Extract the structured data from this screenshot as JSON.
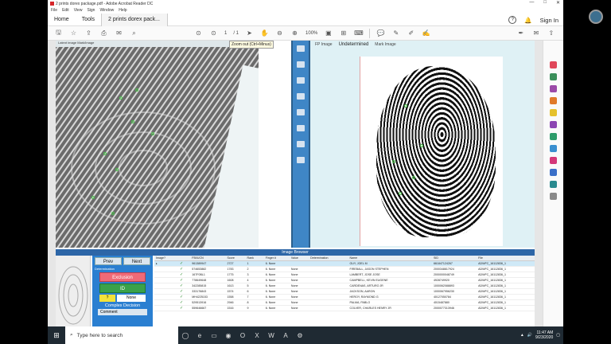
{
  "window": {
    "title": "2 prints dorex package.pdf - Adobe Acrobat Reader DC",
    "controls": [
      "—",
      "□",
      "✕"
    ]
  },
  "menu": [
    "File",
    "Edit",
    "View",
    "Sign",
    "Window",
    "Help"
  ],
  "tabs": {
    "home": "Home",
    "tools": "Tools",
    "document": "2 prints dorex pack...",
    "sign_in": "Sign In"
  },
  "toolbar": {
    "page_current": "1",
    "page_total": "/ 1",
    "zoom": "100%",
    "tooltip": "Zoom out (Ctrl+Minus)"
  },
  "document": {
    "left_header": "Latent image    Mark/Image",
    "right_header": {
      "tab1": "FP Image",
      "status": "Undetermined",
      "tab2": "Mark Image"
    },
    "image_browser_title": "Image Browser",
    "decision_panel": {
      "prev": "Prev",
      "next": "Next",
      "determination_label": "Determination",
      "exclusion": "Exclusion",
      "id": "ID",
      "question": "?",
      "none": "None",
      "complex": "Complex Decision",
      "comment": "Comment"
    },
    "table": {
      "columns": [
        "Image?",
        "",
        "FBI/UCN",
        "Score",
        "Rank",
        "Finger #",
        "Value",
        "Determination",
        "Name",
        "SID",
        "File"
      ],
      "rows": [
        [
          "▸",
          "✓",
          "961389947",
          "2727",
          "1",
          "6. None",
          "",
          "",
          "GUY, JOEL M",
          "661847124267",
          "ADWFC_16112836_1"
        ],
        [
          "",
          "✓",
          "574653882",
          "1783",
          "2",
          "6. None",
          "None",
          "",
          "FIREBALL, JASON STEPHEN",
          "2000348817924",
          "ADWFC_16112836_1"
        ],
        [
          "",
          "✓",
          "167F0BL1",
          "1775",
          "3",
          "6. None",
          "None",
          "",
          "LAMBERT, JOSE JOSE",
          "2000000048749",
          "ADWFC_16112836_1"
        ],
        [
          "",
          "✓",
          "778649648",
          "1608",
          "4",
          "6. None",
          "None",
          "",
          "CAMPBELL, KEVIN EUGENE",
          "4928749920",
          "ADWFC_16112836_1"
        ],
        [
          "",
          "✓",
          "342285815",
          "1613",
          "5",
          "6. None",
          "None",
          "",
          "CARDENAS, ARTURO JR",
          "1000062088893",
          "ADWFC_16112836_1"
        ],
        [
          "",
          "✓",
          "333176843",
          "1574",
          "6",
          "6. None",
          "None",
          "",
          "JACKSON, AARON",
          "1000067956230",
          "ADWFC_16112836_1"
        ],
        [
          "",
          "✓",
          "MH4225153",
          "1558",
          "7",
          "6. None",
          "None",
          "",
          "HEROY, RAYMOND G",
          "40127050784",
          "ADWFC_16112836_1"
        ],
        [
          "",
          "✓",
          "529513916",
          "2946",
          "8",
          "6. None",
          "None",
          "",
          "PALMA, PABLO",
          "4015487880",
          "ADWFC_16112836_1"
        ],
        [
          "",
          "✓",
          "559646667",
          "1516",
          "9",
          "6. None",
          "None",
          "",
          "COLVER, CHARLES HENRY JR",
          "2000077313946",
          "ADWFC_16112836_1"
        ]
      ]
    }
  },
  "taskbar": {
    "search_placeholder": "Type here to search",
    "time": "11:47 AM",
    "date": "9/23/2020"
  },
  "colors": {
    "accent_blue": "#2d66a7",
    "exclusion": "#f06a77",
    "id_green": "#3aa24a"
  }
}
